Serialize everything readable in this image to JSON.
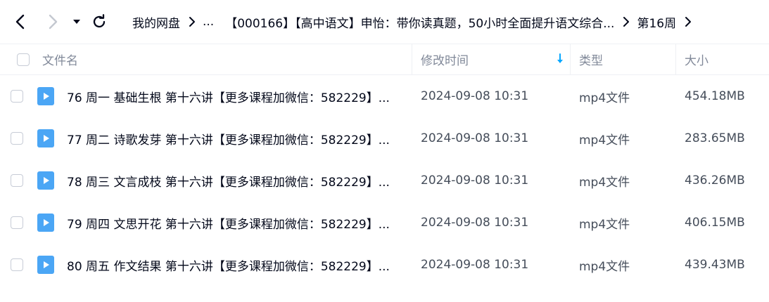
{
  "toolbar": {
    "back_icon": "chevron-left-icon",
    "forward_icon": "chevron-right-icon",
    "history_icon": "caret-down-icon",
    "refresh_icon": "refresh-icon"
  },
  "breadcrumb": [
    {
      "label": "我的网盘"
    },
    {
      "label": "..."
    },
    {
      "label": "【000166】【高中语文】申怡：带你读真题，50小时全面提升语文综合..."
    },
    {
      "label": "第16周"
    }
  ],
  "table": {
    "headers": {
      "name": "文件名",
      "modified": "修改时间",
      "type": "类型",
      "size": "大小"
    },
    "sort_column": "modified",
    "sort_direction": "descending",
    "rows": [
      {
        "name": "76 周一 基础生根 第十六讲【更多课程加微信：582229】...",
        "modified": "2024-09-08 10:31",
        "type": "mp4文件",
        "size": "454.18MB",
        "icon": "video-file-icon"
      },
      {
        "name": "77 周二 诗歌发芽 第十六讲【更多课程加微信：582229】...",
        "modified": "2024-09-08 10:31",
        "type": "mp4文件",
        "size": "283.65MB",
        "icon": "video-file-icon"
      },
      {
        "name": "78 周三 文言成枝 第十六讲【更多课程加微信：582229】...",
        "modified": "2024-09-08 10:31",
        "type": "mp4文件",
        "size": "436.26MB",
        "icon": "video-file-icon"
      },
      {
        "name": "79 周四 文思开花 第十六讲【更多课程加微信：582229】...",
        "modified": "2024-09-08 10:31",
        "type": "mp4文件",
        "size": "406.15MB",
        "icon": "video-file-icon"
      },
      {
        "name": "80 周五 作文结果 第十六讲【更多课程加微信：582229】...",
        "modified": "2024-09-08 10:31",
        "type": "mp4文件",
        "size": "439.43MB",
        "icon": "video-file-icon"
      }
    ]
  },
  "colors": {
    "accent": "#06a7ff",
    "video_icon": "#4ba6f5",
    "header_text": "#818999",
    "divider": "#eef0f4"
  }
}
